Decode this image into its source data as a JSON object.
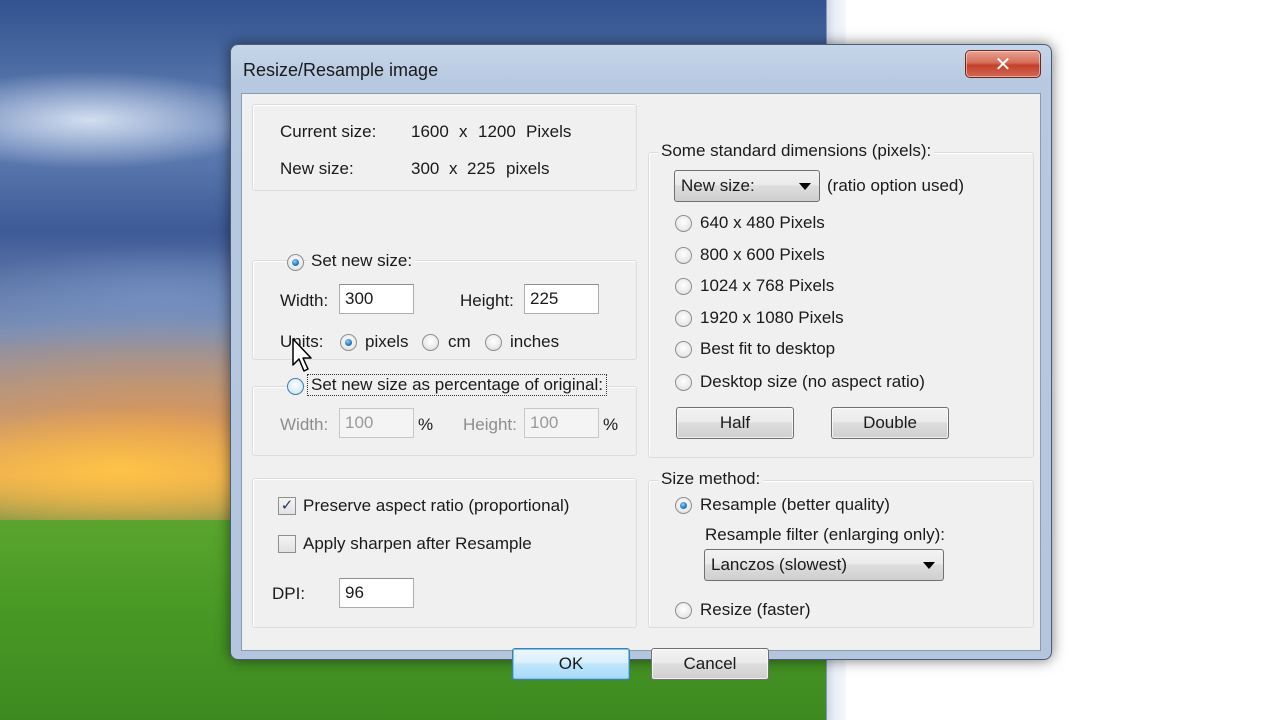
{
  "dialog": {
    "title": "Resize/Resample image",
    "close_glyph": "✕"
  },
  "info": {
    "current_label": "Current size:",
    "current_w": "1600",
    "current_x": "x",
    "current_h": "1200",
    "current_unit": "Pixels",
    "new_label": "New size:",
    "new_w": "300",
    "new_x": "x",
    "new_h": "225",
    "new_unit": "pixels"
  },
  "set_new_size": {
    "label": "Set new size:",
    "selected": true,
    "width_label": "Width:",
    "width_value": "300",
    "height_label": "Height:",
    "height_value": "225",
    "units_label": "Units:",
    "units": [
      "pixels",
      "cm",
      "inches"
    ],
    "selected_unit": "pixels"
  },
  "percentage": {
    "label": "Set new size as percentage of original:",
    "selected": false,
    "width_label": "Width:",
    "width_value": "100",
    "height_label": "Height:",
    "height_value": "100",
    "percent": "%"
  },
  "options": {
    "preserve_label": "Preserve aspect ratio (proportional)",
    "preserve_checked": true,
    "check_glyph": "✓",
    "sharpen_label": "Apply sharpen after Resample",
    "sharpen_checked": false,
    "dpi_label": "DPI:",
    "dpi_value": "96"
  },
  "standard": {
    "title": "Some standard dimensions (pixels):",
    "combo_value": "New size:",
    "ratio_note": "(ratio option used)",
    "items": [
      "640 x 480 Pixels",
      "800 x 600 Pixels",
      "1024 x 768 Pixels",
      "1920 x 1080 Pixels",
      "Best fit to desktop",
      "Desktop size (no aspect ratio)"
    ],
    "half_label": "Half",
    "double_label": "Double"
  },
  "method": {
    "title": "Size method:",
    "resample_label": "Resample (better quality)",
    "resample_selected": true,
    "filter_label": "Resample filter (enlarging only):",
    "filter_value": "Lanczos (slowest)",
    "resize_label": "Resize (faster)",
    "resize_selected": false
  },
  "footer": {
    "ok_label": "OK",
    "cancel_label": "Cancel"
  },
  "colors": {
    "title_bar": "#b7c9e1",
    "client_bg": "#f0f0f0",
    "close_red": "#c3402a",
    "focus_blue": "#3c7fb1"
  }
}
